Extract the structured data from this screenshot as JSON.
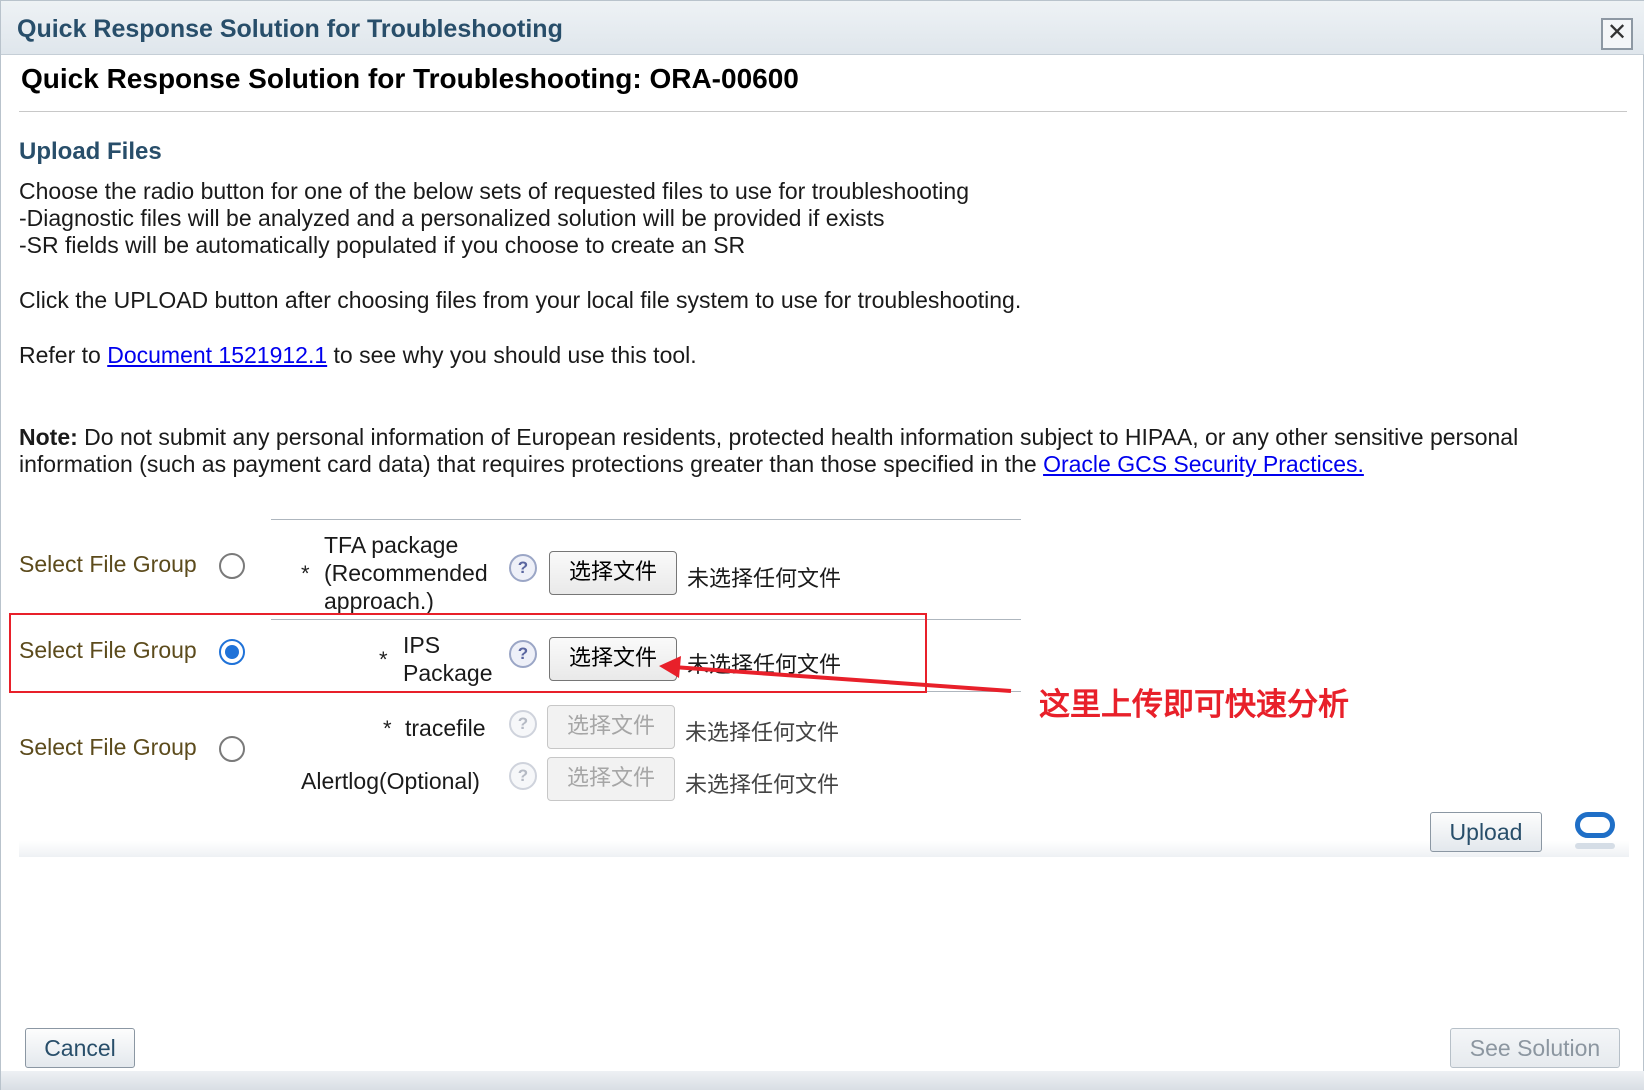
{
  "window": {
    "title": "Quick Response Solution for Troubleshooting",
    "close_label": "✕"
  },
  "page": {
    "title": "Quick Response Solution for Troubleshooting: ORA-00600"
  },
  "upload": {
    "heading": "Upload Files",
    "lines": [
      "Choose the radio button for one of the below sets of requested files to use for troubleshooting",
      "-Diagnostic files will be analyzed and a personalized solution will be provided if exists",
      "-SR fields will be automatically populated if you choose to create an SR"
    ],
    "instruction": "Click the UPLOAD button after choosing files from your local file system to use for troubleshooting.",
    "refer_prefix": "Refer to ",
    "refer_link": "Document 1521912.1",
    "refer_suffix": " to see why you should use this tool.",
    "note_label": "Note:",
    "note_line1": " Do not submit any personal information of European residents, protected health information subject to HIPAA, or any other sensitive personal",
    "note_line2": "information (such as payment card data) that requires protections greater than those specified in the ",
    "note_link": "Oracle GCS Security Practices."
  },
  "groups": [
    {
      "label": "Select File Group",
      "selected": false,
      "fields": [
        {
          "required": "*",
          "label_lines": [
            "TFA package",
            "(Recommended",
            "approach.)"
          ],
          "button": "选择文件",
          "status": "未选择任何文件",
          "enabled": true
        }
      ]
    },
    {
      "label": "Select File Group",
      "selected": true,
      "fields": [
        {
          "required": "*",
          "label_lines": [
            "IPS",
            "Package"
          ],
          "button": "选择文件",
          "status": "未选择任何文件",
          "enabled": true
        }
      ]
    },
    {
      "label": "Select File Group",
      "selected": false,
      "fields": [
        {
          "required": "*",
          "label_lines": [
            "tracefile"
          ],
          "button": "选择文件",
          "status": "未选择任何文件",
          "enabled": false
        },
        {
          "required": "",
          "label_lines": [
            "Alertlog(Optional)"
          ],
          "button": "选择文件",
          "status": "未选择任何文件",
          "enabled": false
        }
      ]
    }
  ],
  "help_glyph": "?",
  "annotation": {
    "text": "这里上传即可快速分析",
    "color": "#e8202a"
  },
  "buttons": {
    "upload": "Upload",
    "cancel": "Cancel",
    "see_solution": "See Solution"
  },
  "colors": {
    "heading": "#284e6a",
    "group_label": "#5c4b1c",
    "link": "#0000ee",
    "radio_selected": "#1f72d8"
  }
}
